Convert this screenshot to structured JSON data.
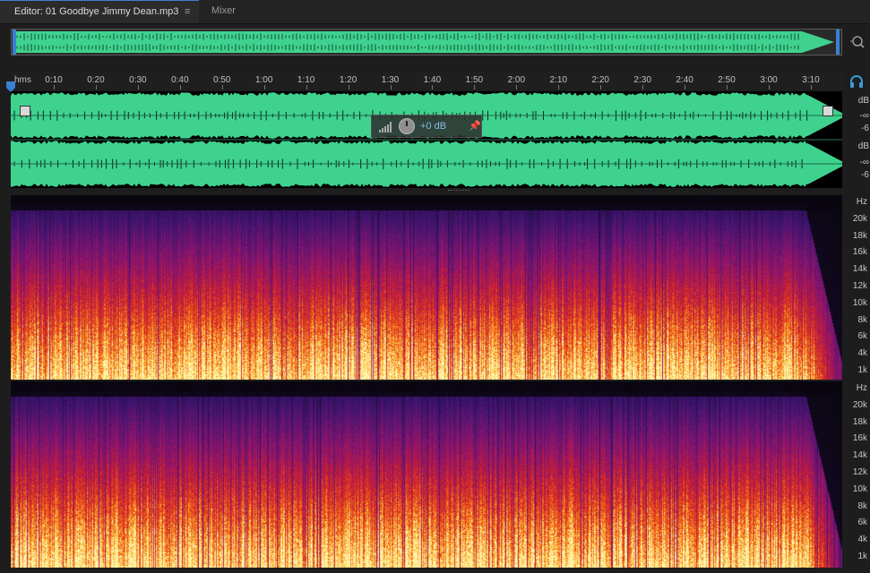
{
  "tabs": {
    "editor_label": "Editor: 01 Goodbye Jimmy Dean.mp3",
    "menu_glyph": "≡",
    "mixer_label": "Mixer"
  },
  "ruler": {
    "unit_label": "hms",
    "ticks": [
      "0:10",
      "0:20",
      "0:30",
      "0:40",
      "0:50",
      "1:00",
      "1:10",
      "1:20",
      "1:30",
      "1:40",
      "1:50",
      "2:00",
      "2:10",
      "2:20",
      "2:30",
      "2:40",
      "2:50",
      "3:00",
      "3:10"
    ]
  },
  "hud": {
    "volume": "+0 dB"
  },
  "db_scale": {
    "ch1": [
      "dB",
      "-∞",
      "-6"
    ],
    "ch2": [
      "dB",
      "-∞",
      "-6"
    ]
  },
  "hz_scale": [
    "Hz",
    "20k",
    "18k",
    "16k",
    "14k",
    "12k",
    "10k",
    "8k",
    "6k",
    "4k",
    "1k"
  ],
  "colors": {
    "waveform": "#3fd28f",
    "accent": "#3a7fd5"
  },
  "icons": {
    "zoom": "zoom-magnifier-icon",
    "headphones": "headphones-icon",
    "playhead": "playhead-marker-icon",
    "pin": "pin-icon"
  }
}
